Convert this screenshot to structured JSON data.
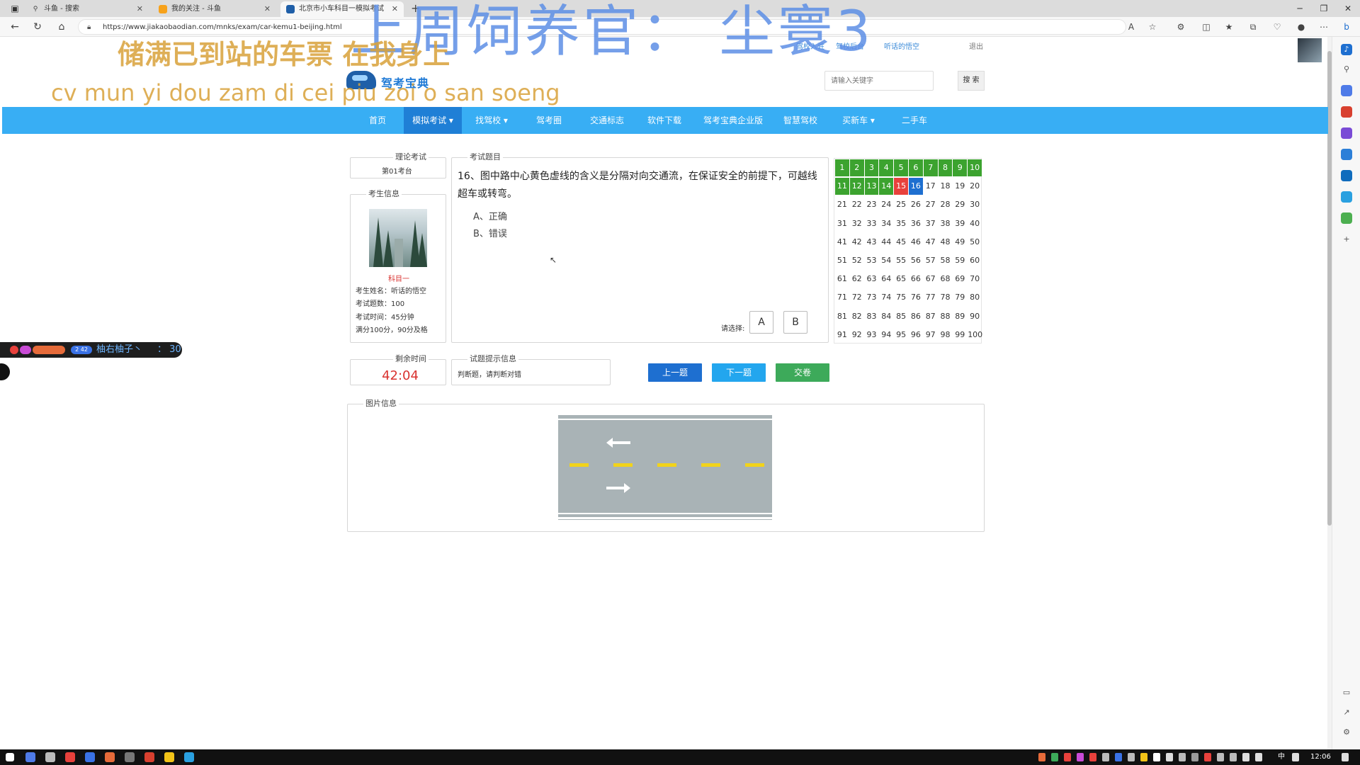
{
  "browser": {
    "tabs": [
      {
        "title": "斗鱼 - 搜索"
      },
      {
        "title": "我的关注 - 斗鱼"
      },
      {
        "title": "北京市小车科目一模拟考试"
      }
    ],
    "new_tab": "+",
    "url": "https://www.jiakaobaodian.com/mnks/exam/car-kemu1-beijing.html"
  },
  "site": {
    "top_links": [
      "驾校入驻",
      "驾校后台",
      "听话的悟空"
    ],
    "logout": "退出",
    "logo_text": "驾考宝典",
    "search_placeholder": "请输入关键字",
    "search_button": "搜 索",
    "nav": [
      {
        "label": "首页"
      },
      {
        "label": "模拟考试 ▾"
      },
      {
        "label": "找驾校 ▾"
      },
      {
        "label": "驾考圈"
      },
      {
        "label": "交通标志"
      },
      {
        "label": "软件下载"
      },
      {
        "label": "驾考宝典企业版"
      },
      {
        "label": "智慧驾校"
      },
      {
        "label": "买新车 ▾"
      },
      {
        "label": "二手车"
      }
    ]
  },
  "exam": {
    "theory_legend": "理论考试",
    "seat": "第01考台",
    "info_legend": "考生信息",
    "subject": "科目一",
    "name_line": "考生姓名：听话的悟空",
    "count_line": "考试题数：100",
    "time_line": "考试时间：45分钟",
    "score_line": "满分100分，90分及格",
    "question_legend": "考试题目",
    "question": "16、图中路中心黄色虚线的含义是分隔对向交通流，在保证安全的前提下，可越线超车或转弯。",
    "options": [
      "A、正确",
      "B、错误"
    ],
    "choose_label": "请选择:",
    "choice_a": "A",
    "choice_b": "B",
    "remaining_legend": "剩余时间",
    "remaining_time": "42:04",
    "hint_legend": "试题提示信息",
    "hint_text": "判断题，请判断对错",
    "prev_button": "上一题",
    "next_button": "下一题",
    "submit_button": "交卷",
    "image_legend": "图片信息",
    "grid": {
      "done": [
        1,
        2,
        3,
        4,
        5,
        6,
        7,
        8,
        9,
        10,
        11,
        12,
        13,
        14
      ],
      "wrong": [
        15
      ],
      "current": 16,
      "total": 100
    }
  },
  "overlay": {
    "big_text": "上周饲养官：   尘寰3",
    "lyric_cn": "储满已到站的车票 在我身上",
    "lyric_py": "cv mun yi dou zam di cei piu zoi o san soeng",
    "danmu_user": "柚右柚子丶",
    "danmu_msg": "：  30",
    "danmu_badge": "2 42"
  },
  "taskbar": {
    "ime": "中",
    "clock": "12:06"
  },
  "colors": {
    "nav_bg": "#38aef4",
    "nav_active": "#1f7fd6",
    "done": "#3ca32f",
    "wrong": "#e8413c",
    "current": "#1e6fd0",
    "timer": "#d9322f"
  }
}
